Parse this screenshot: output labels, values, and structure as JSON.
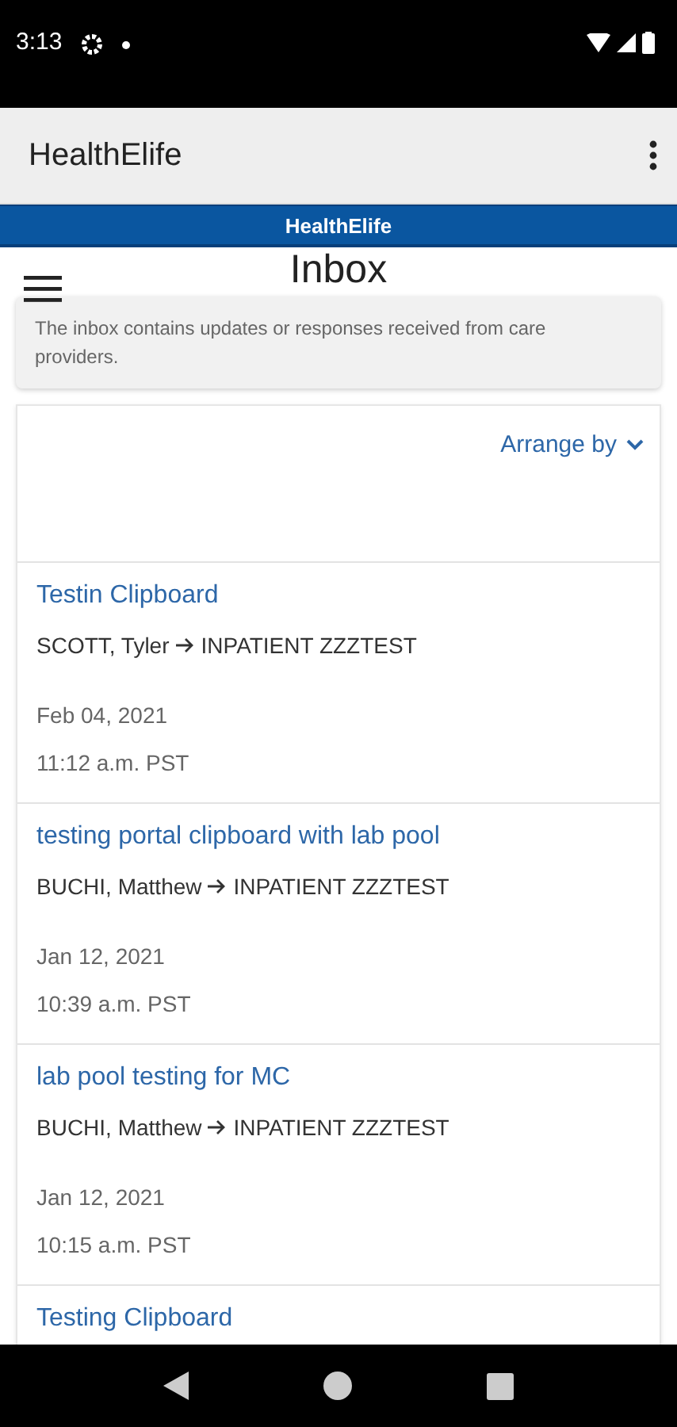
{
  "status_bar": {
    "time": "3:13"
  },
  "app_bar": {
    "title": "HealthElife"
  },
  "banner": {
    "title": "HealthElife"
  },
  "header": {
    "title": "Inbox"
  },
  "info": {
    "text": "The inbox contains updates or responses received from care providers."
  },
  "arrange": {
    "label": "Arrange by"
  },
  "messages": [
    {
      "subject": "Testin Clipboard",
      "sender": "SCOTT, Tyler",
      "recipient": "INPATIENT ZZZTEST",
      "date": "Feb 04, 2021",
      "time": "11:12 a.m. PST"
    },
    {
      "subject": "testing portal clipboard with lab pool",
      "sender": "BUCHI, Matthew",
      "recipient": "INPATIENT ZZZTEST",
      "date": "Jan 12, 2021",
      "time": "10:39 a.m. PST"
    },
    {
      "subject": "lab pool testing for MC",
      "sender": "BUCHI, Matthew",
      "recipient": "INPATIENT ZZZTEST",
      "date": "Jan 12, 2021",
      "time": "10:15 a.m. PST"
    },
    {
      "subject": "Testing Clipboard"
    }
  ]
}
